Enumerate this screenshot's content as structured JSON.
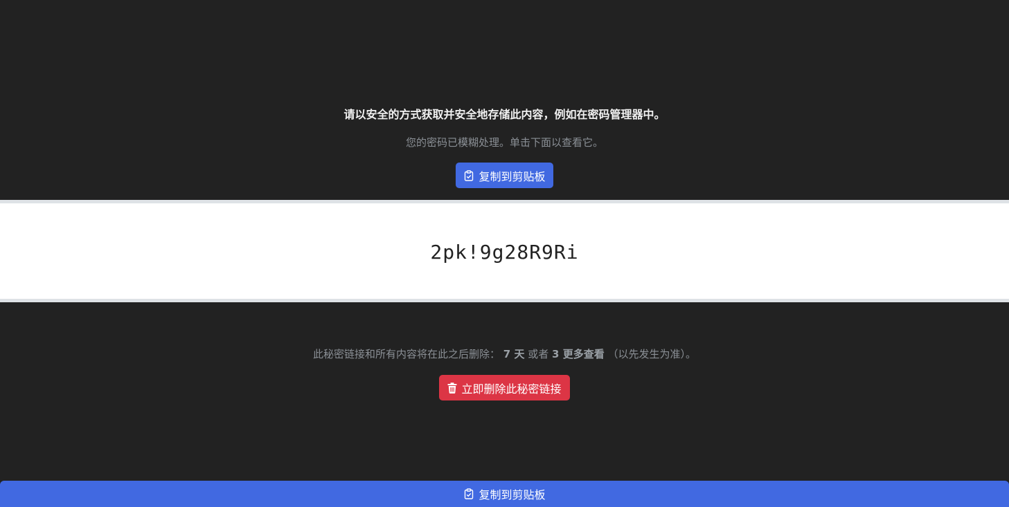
{
  "header": {
    "warning": "请以安全的方式获取并安全地存储此内容，例如在密码管理器中。",
    "hint": "您的密码已模糊处理。单击下面以查看它。"
  },
  "buttons": {
    "copy_label": "复制到剪贴板",
    "copy_icon": "clipboard-check-icon",
    "delete_label": "立即删除此秘密链接",
    "delete_icon": "trash-icon"
  },
  "secret": {
    "value": "2pk!9g28R9Ri"
  },
  "expiry": {
    "prefix": "此秘密链接和所有内容将在此之后删除：",
    "days": "7 天",
    "or": "或者",
    "views": "3 更多查看",
    "suffix": "（以先发生为准）。"
  },
  "colors": {
    "background": "#222222",
    "primary": "#4169e1",
    "danger": "#dc3545",
    "muted_text": "#8b9096"
  }
}
